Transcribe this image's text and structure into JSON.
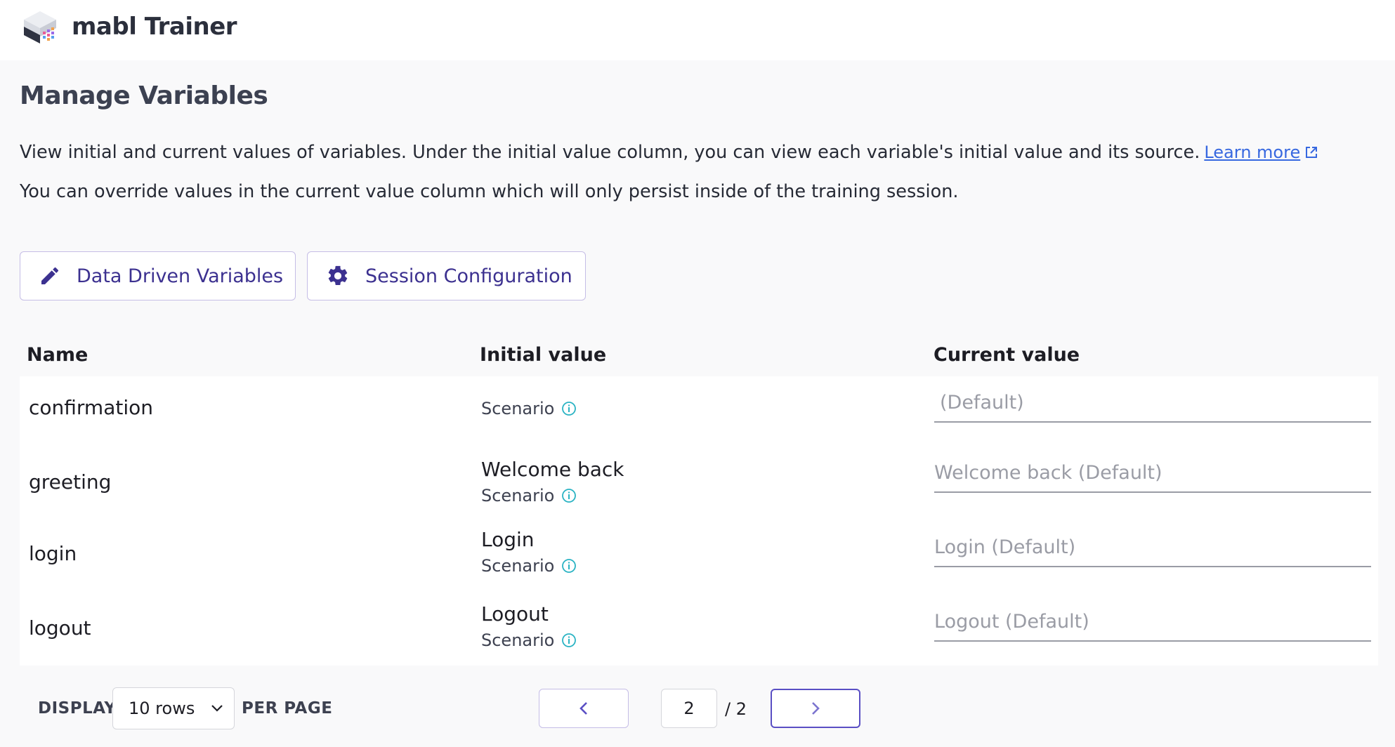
{
  "header": {
    "app_title": "mabl Trainer",
    "logo_icon": "mabl-cube-logo-icon"
  },
  "page": {
    "title": "Manage Variables",
    "description_line1": "View initial and current values of variables. Under the initial value column, you can view each variable's initial value and its source.",
    "learn_more": "Learn more",
    "description_line2": "You can override values in the current value column which will only persist inside of the training session."
  },
  "toolbar": {
    "data_driven_label": "Data Driven Variables",
    "data_driven_icon": "pencil-icon",
    "session_config_label": "Session Configuration",
    "session_config_icon": "gear-icon"
  },
  "table": {
    "headers": {
      "name": "Name",
      "initial_value": "Initial value",
      "current_value": "Current value"
    },
    "rows": [
      {
        "name": "confirmation",
        "initial_value": "",
        "source": "Scenario",
        "current_placeholder": "(Default)"
      },
      {
        "name": "greeting",
        "initial_value": "Welcome back",
        "source": "Scenario",
        "current_placeholder": "Welcome back (Default)"
      },
      {
        "name": "login",
        "initial_value": "Login",
        "source": "Scenario",
        "current_placeholder": "Login (Default)"
      },
      {
        "name": "logout",
        "initial_value": "Logout",
        "source": "Scenario",
        "current_placeholder": "Logout (Default)"
      }
    ]
  },
  "pagination": {
    "display_label": "DISPLAY",
    "rows_option": "10 rows",
    "per_page_label": "PER PAGE",
    "current_page": "2",
    "total_pages": "/ 2",
    "prev_icon": "chevron-left-icon",
    "next_icon": "chevron-right-icon"
  },
  "colors": {
    "accent": "#3c3190",
    "button_border": "#c5bde6",
    "link": "#3768e0",
    "info_icon": "#2ab3c3"
  }
}
